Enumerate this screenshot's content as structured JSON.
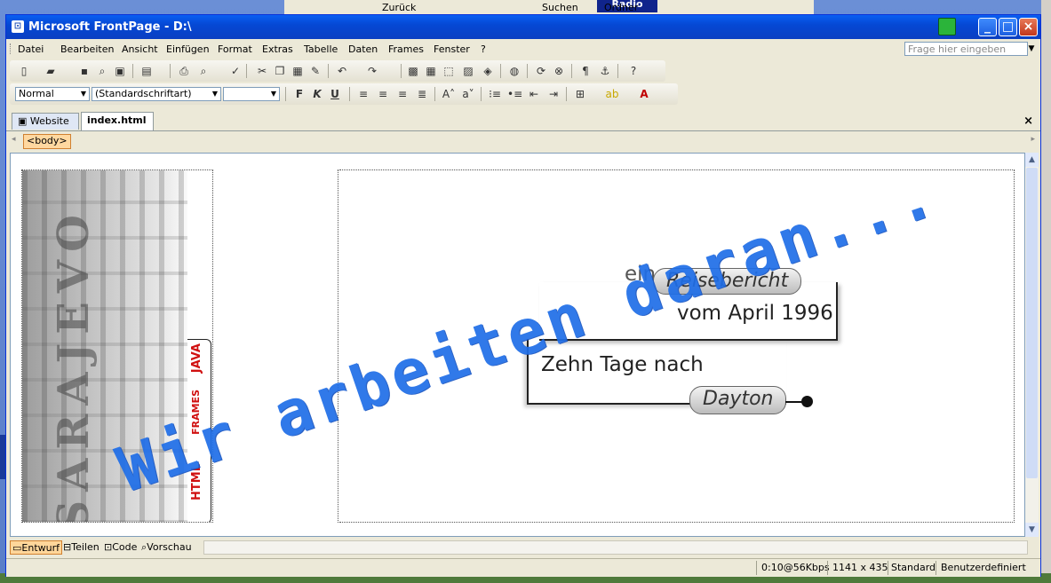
{
  "background": {
    "radio_label": "Radio",
    "back_label": "Zurück",
    "search_label": "Suchen",
    "folders_label": "Ordner"
  },
  "window": {
    "title": "Microsoft FrontPage - D:\\"
  },
  "menu": {
    "items": [
      "Datei",
      "Bearbeiten",
      "Ansicht",
      "Einfügen",
      "Format",
      "Extras",
      "Tabelle",
      "Daten",
      "Frames",
      "Fenster",
      "?"
    ],
    "help_placeholder": "Frage hier eingeben"
  },
  "formatting": {
    "style": "Normal",
    "font": "(Standardschriftart)",
    "size": "",
    "bold": "F",
    "italic": "K",
    "underline": "U"
  },
  "tabs": {
    "website": "Website",
    "document": "index.html"
  },
  "tag_selector": {
    "tag": "<body>"
  },
  "page": {
    "side_tabs": [
      "JAVA",
      "FRAMES",
      "HTML"
    ],
    "box1_pill": "Reisebericht",
    "box1_prefix": "ein",
    "box1_text": "vom April 1996",
    "box2_text": "Zehn Tage nach",
    "box2_pill": "Dayton",
    "overlay": "Wir arbeiten daran..."
  },
  "views": {
    "design": "Entwurf",
    "split": "Teilen",
    "code": "Code",
    "preview": "Vorschau"
  },
  "status": {
    "speed": "0:10@56Kbps",
    "dimensions": "1141 x 435",
    "mode": "Standard",
    "custom": "Benutzerdefiniert"
  }
}
